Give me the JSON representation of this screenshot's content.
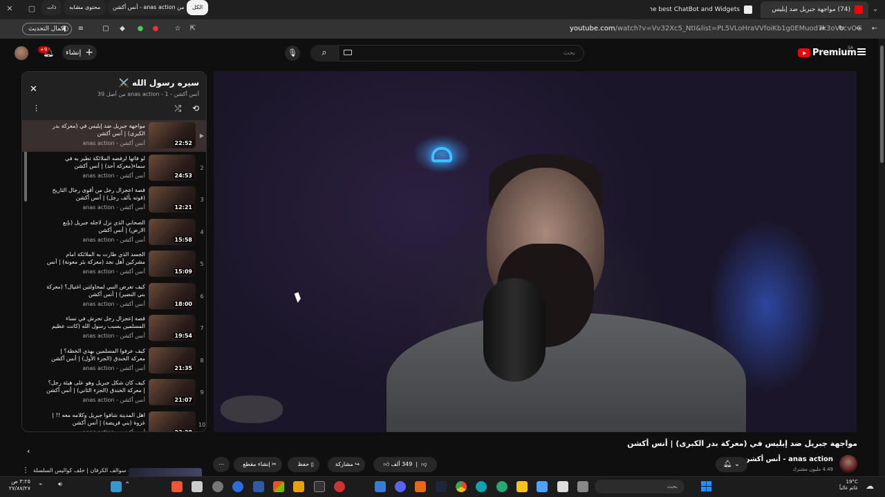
{
  "browser": {
    "tabs": [
      {
        "title": "(74) مواجهة جبريل ضد إبليس",
        "active": true,
        "favicon_color": "#ff0000"
      },
      {
        "title": "The best ChatBot and Widgets",
        "active": false,
        "favicon_color": "#eeeeee"
      }
    ],
    "update_button": "إكمال التحديث",
    "url_host": "youtube.com",
    "url_path": "/watch?v=Vv32Xc5_NtI&list=PL5VLoHraVVfoiKb1g0EMuod7k3oVecvOG"
  },
  "header": {
    "logo_word": "Premium",
    "logo_cc": "SA",
    "search_placeholder": "بحث",
    "create_label": "إنشاء",
    "notification_count": "+9"
  },
  "playlist": {
    "title": "سيره رسول الله ⚔️",
    "subtitle": "أنس أكشن - anas action - 1 من أصل 39",
    "items": [
      {
        "index": "▶",
        "title": "مواجهة جبريل ضد إبليس في (معركة بدر الكبرى) | أنس أكشن",
        "channel": "أنس أكشن - anas action",
        "duration": "22:52",
        "active": true
      },
      {
        "index": "2",
        "title": "لو فاتها لرفضه الملائكة تطير به في سماء(معركة أحد) | أنس أكشن",
        "channel": "أنس أكشن - anas action",
        "duration": "24:53",
        "active": false
      },
      {
        "index": "3",
        "title": "قصة اعجزال رجل من أقوى رجال التاريخ (قوته بألف رجل) | أنس أكشن",
        "channel": "أنس أكشن - anas action",
        "duration": "12:21",
        "active": false
      },
      {
        "index": "4",
        "title": "الصحابي الذي نزل لاجله جبريل (بإبع الارض) | أنس أكشن",
        "channel": "أنس أكشن - anas action",
        "duration": "15:58",
        "active": false
      },
      {
        "index": "5",
        "title": "الجسد الذي طارت به الملائكة امام مشركين أهل نجد (معركة بئر معونة) | أنس أكشن",
        "channel": "أنس أكشن - anas action",
        "duration": "15:09",
        "active": false
      },
      {
        "index": "6",
        "title": "كيف تعرض النبي لمحاولتين اغتيال؟ (معركة بني النضير) | أنس أكشن",
        "channel": "أنس أكشن - anas action",
        "duration": "18:00",
        "active": false
      },
      {
        "index": "7",
        "title": "قصة إعجزال رجل تحرش في نساء المسلمين بسبب رسول الله (كانت عظيم بتحتال!!) | ...",
        "channel": "أنس أكشن - anas action",
        "duration": "19:54",
        "active": false
      },
      {
        "index": "8",
        "title": "كيف عرفوا المسلمين بهذي الخطة؟ | معركة الخندق (الجزء الأول) | أنس أكشن",
        "channel": "أنس أكشن - anas action",
        "duration": "21:35",
        "active": false
      },
      {
        "index": "9",
        "title": "كيف كان شكل جبريل وهو على هيئة رجل؟ | معركة الخندق (الجزء الثاني) | أنس أكشن",
        "channel": "أنس أكشن - anas action",
        "duration": "21:07",
        "active": false
      },
      {
        "index": "10",
        "title": "اهل المدينة شافوا جبريل وكلامه معه !! | غزوة (بني قريضة) | أنس أكشن",
        "channel": "أنس أكشن - anas action",
        "duration": "23:28",
        "active": false
      }
    ]
  },
  "chips": [
    "الكل",
    "من anas action - أنس أكشن",
    "محتوى مشابه",
    "ذات"
  ],
  "recommendation": {
    "title": "جلسة سوالف الكرفان | خلف كواليس السلسلة"
  },
  "video": {
    "title": "مواجهة جبريل ضد إبليس في (معركة بدر الكبرى) | أنس أكشن",
    "channel_name": "anas action - أنس أكشن",
    "subscribers": "4.49 مليون مشترك",
    "likes": "349 ألف",
    "share_label": "مشاركة",
    "save_label": "حفظ",
    "clip_label": "إنشاء مقطع"
  },
  "taskbar": {
    "search_placeholder": "بحث",
    "weather_temp": "19°C",
    "weather_desc": "غائم غالباً",
    "time": "٣:٢٥ ص",
    "date": "٢٧/٨٧/٢٧"
  },
  "colors": {
    "youtube_red": "#ff0000",
    "background": "#0f0f0f",
    "chip_bg": "#272727"
  }
}
